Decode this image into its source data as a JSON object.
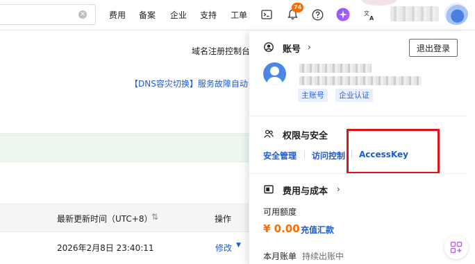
{
  "topbar": {
    "search_value": "",
    "nav_items": [
      "费用",
      "备案",
      "企业",
      "支持",
      "工单"
    ],
    "notification_count": "74"
  },
  "background": {
    "domain_console_label": "域名注册控制台",
    "dns_notice": "【DNS容灾切换】服务故障自动切",
    "table_headers": {
      "update_time": "最新更新时间（UTC+8）",
      "actions": "操作"
    },
    "row": {
      "update_time": "2026年2月8日 23:40:11",
      "modify": "修改"
    }
  },
  "panel": {
    "account": {
      "title": "账号",
      "logout": "退出登录",
      "tags": [
        "主账号",
        "企业认证"
      ]
    },
    "security": {
      "title": "权限与安全",
      "links": [
        "安全管理",
        "访问控制",
        "AccessKey"
      ]
    },
    "billing": {
      "title": "费用与成本",
      "balance_label": "可用额度",
      "balance": "¥ 0.00",
      "topup": "充值汇款",
      "monthly_bill": "本月账单",
      "bill_status": "持续出账中"
    }
  },
  "colors": {
    "accent_blue": "#1d5ad6",
    "highlight_red": "#e0121d",
    "balance_orange": "#ff6a00"
  }
}
